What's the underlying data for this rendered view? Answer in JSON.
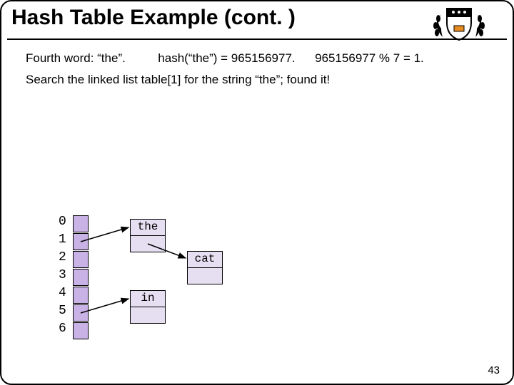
{
  "title": "Hash Table Example (cont. )",
  "line1_a": "Fourth word:  “the”.",
  "line1_b": "hash(“the”) = 965156977.",
  "line1_c": "965156977 % 7 = 1.",
  "line2": "Search the linked list   table[1]  for the string “the”; found it!",
  "indices": [
    "0",
    "1",
    "2",
    "3",
    "4",
    "5",
    "6"
  ],
  "nodes": {
    "the": "the",
    "cat": "cat",
    "in": "in"
  },
  "page_number": "43",
  "chart_data": {
    "type": "table",
    "description": "Hash table with 7 buckets (indices 0-6). Bucket 1 -> node 'the' -> node 'cat'. Bucket 5 -> node 'in'.",
    "buckets": 7,
    "chains": [
      {
        "index": 1,
        "items": [
          "the",
          "cat"
        ]
      },
      {
        "index": 5,
        "items": [
          "in"
        ]
      }
    ],
    "hash_example": {
      "word": "the",
      "hash": 965156977,
      "modulus": 7,
      "bucket": 1
    }
  }
}
